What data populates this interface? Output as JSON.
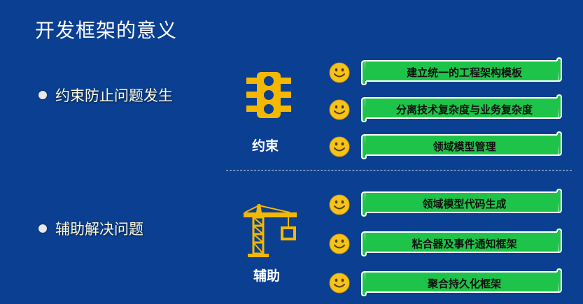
{
  "title": "开发框架的意义",
  "bullets": [
    "约束防止问题发生",
    "辅助解决问题"
  ],
  "categories": {
    "constraint": {
      "label": "约束",
      "icon": "traffic-light-icon"
    },
    "assist": {
      "label": "辅助",
      "icon": "crane-icon"
    }
  },
  "constraint_items": [
    "建立统一的工程架构模板",
    "分离技术复杂度与业务复杂度",
    "领域模型管理"
  ],
  "assist_items": [
    "领域模型代码生成",
    "粘合器及事件通知框架",
    "聚合持久化框架"
  ],
  "colors": {
    "background": "#0a3f91",
    "banner_fill": "#1ec449",
    "icon_yellow": "#f5b800",
    "smiley": "#f6c31b"
  }
}
